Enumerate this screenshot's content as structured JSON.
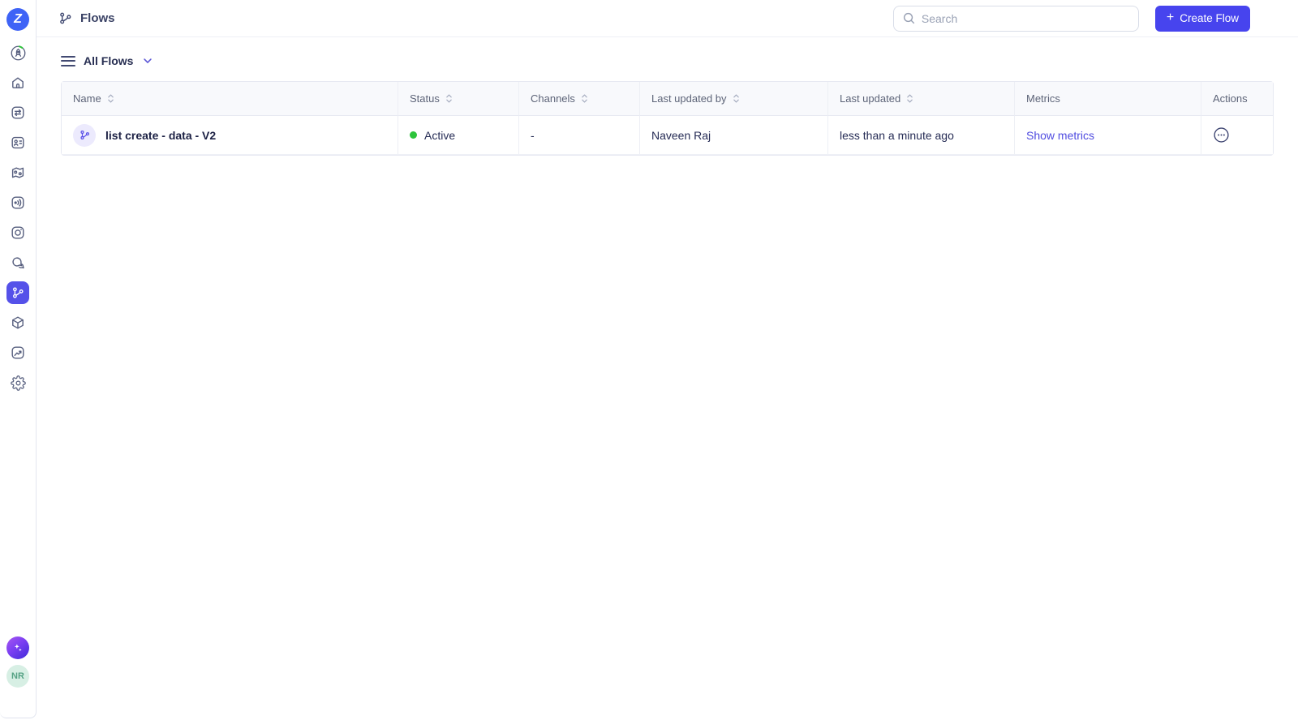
{
  "app": {
    "logo_letter": "Z"
  },
  "header": {
    "title": "Flows",
    "search_placeholder": "Search",
    "create_flow_label": "Create Flow",
    "create_flow_icon": "+"
  },
  "toolbar": {
    "view_label": "All Flows"
  },
  "sidebar": {
    "icons": [
      "rocket-icon",
      "home-icon",
      "swap-arrows-icon",
      "contacts-icon",
      "journey-map-icon",
      "broadcast-icon",
      "camera-icon",
      "chat-icon",
      "flows-icon",
      "cube-icon",
      "analytics-icon",
      "settings-gear-icon"
    ],
    "active_item": "flows",
    "ai_assistant_icon": "sparkles-icon",
    "user_avatar_initials": "NR"
  },
  "table": {
    "columns": [
      {
        "label": "Name",
        "sortable": true
      },
      {
        "label": "Status",
        "sortable": true
      },
      {
        "label": "Channels",
        "sortable": true
      },
      {
        "label": "Last updated by",
        "sortable": true
      },
      {
        "label": "Last updated",
        "sortable": true
      },
      {
        "label": "Metrics",
        "sortable": false
      },
      {
        "label": "Actions",
        "sortable": false
      }
    ],
    "rows": [
      {
        "name": "list create - data - V2",
        "status": "Active",
        "channels": "-",
        "last_updated_by": "Naveen Raj",
        "last_updated": "less than a minute ago",
        "metrics_link": "Show metrics",
        "actions_icon": "ellipsis-circle-icon"
      }
    ]
  },
  "colors": {
    "accent_indigo": "#4744ee",
    "active_nav_indigo": "#5551e9",
    "link_indigo": "#4f4be0",
    "logo_blue": "#3e63f6",
    "status_green": "#2dc43b",
    "flow_avatar_bg": "#eceafd",
    "user_avatar_bg": "#d7efe4",
    "user_avatar_text": "#55a284"
  }
}
